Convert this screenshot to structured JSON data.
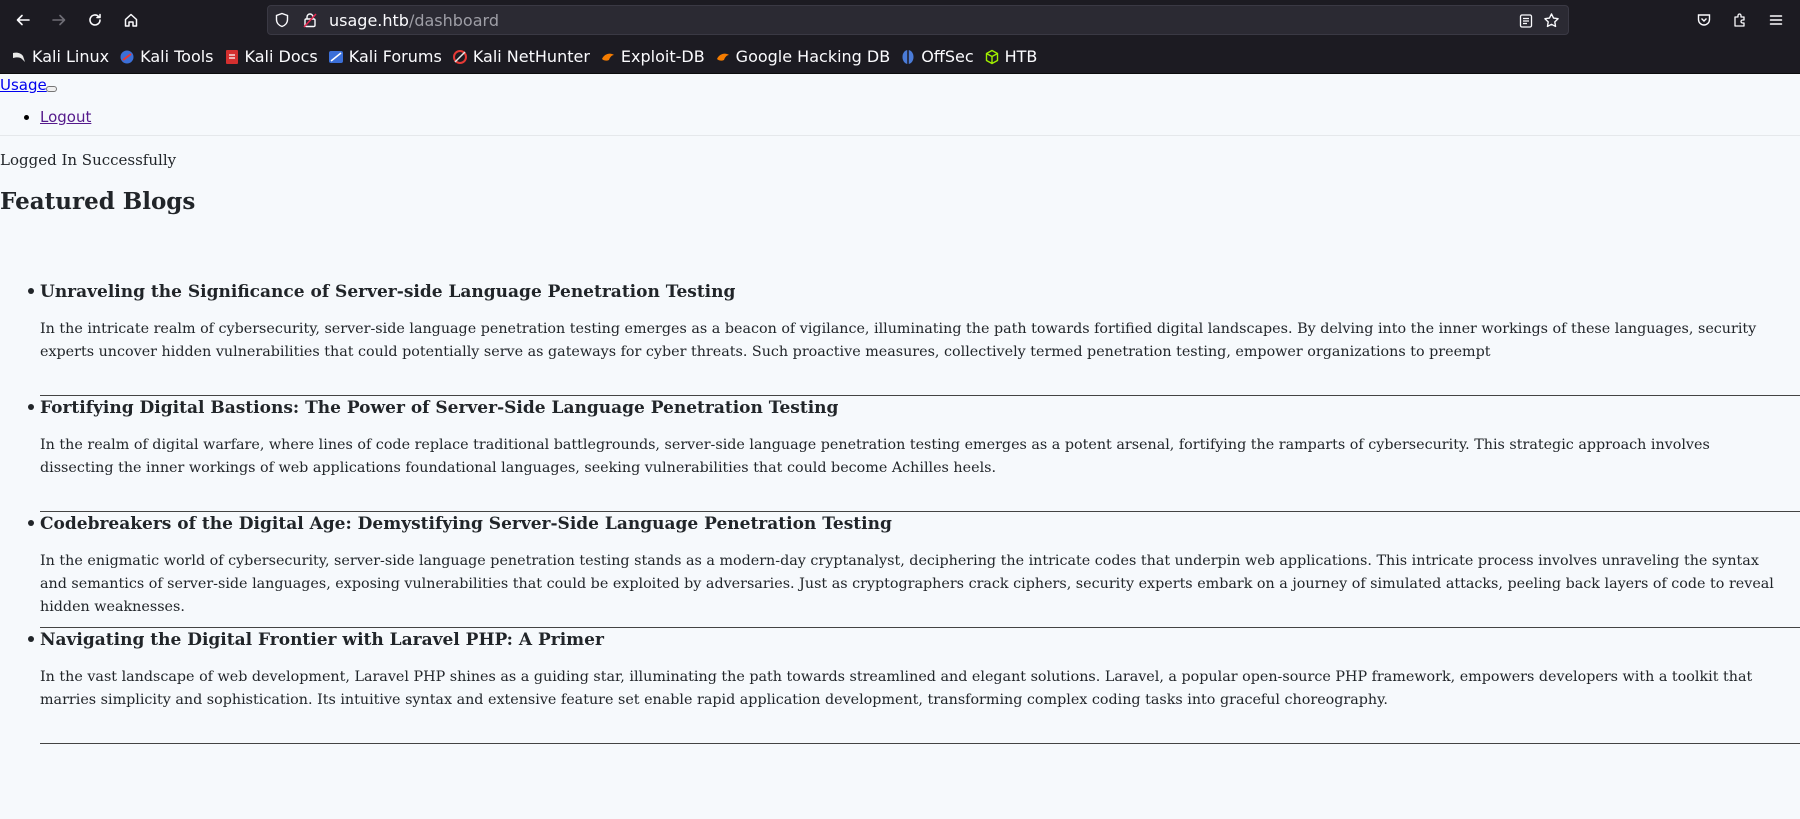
{
  "browser": {
    "url_host": "usage.htb",
    "url_path": "/dashboard",
    "bookmarks": [
      {
        "label": "Kali Linux",
        "icon": "kali-dragon-icon",
        "color": "#2d8ed8"
      },
      {
        "label": "Kali Tools",
        "icon": "kali-tools-icon",
        "color": "#3b6fd8"
      },
      {
        "label": "Kali Docs",
        "icon": "kali-docs-icon",
        "color": "#d32f2f"
      },
      {
        "label": "Kali Forums",
        "icon": "kali-forums-icon",
        "color": "#3b6fd8"
      },
      {
        "label": "Kali NetHunter",
        "icon": "nethunter-icon",
        "color": "#e53935"
      },
      {
        "label": "Exploit-DB",
        "icon": "exploit-db-icon",
        "color": "#f57c00"
      },
      {
        "label": "Google Hacking DB",
        "icon": "ghdb-icon",
        "color": "#f57c00"
      },
      {
        "label": "OffSec",
        "icon": "offsec-icon",
        "color": "#4a7bd8"
      },
      {
        "label": "HTB",
        "icon": "htb-cube-icon",
        "color": "#9fef00"
      }
    ]
  },
  "navbar": {
    "brand": "Usage",
    "logout": "Logout"
  },
  "status_text": "Logged In Successfully",
  "section_title": "Featured Blogs",
  "blogs": [
    {
      "title": "Unraveling the Significance of Server-side Language Penetration Testing",
      "body": "In the intricate realm of cybersecurity, server-side language penetration testing emerges as a beacon of vigilance, illuminating the path towards fortified digital landscapes. By delving into the inner workings of these languages, security experts uncover hidden vulnerabilities that could potentially serve as gateways for cyber threats. Such proactive measures, collectively termed penetration testing, empower organizations to preempt"
    },
    {
      "title": "Fortifying Digital Bastions: The Power of Server-Side Language Penetration Testing",
      "body": "In the realm of digital warfare, where lines of code replace traditional battlegrounds, server-side language penetration testing emerges as a potent arsenal, fortifying the ramparts of cybersecurity. This strategic approach involves dissecting the inner workings of web applications foundational languages, seeking vulnerabilities that could become Achilles heels."
    },
    {
      "title": "Codebreakers of the Digital Age: Demystifying Server-Side Language Penetration Testing",
      "body": "In the enigmatic world of cybersecurity, server-side language penetration testing stands as a modern-day cryptanalyst, deciphering the intricate codes that underpin web applications. This intricate process involves unraveling the syntax and semantics of server-side languages, exposing vulnerabilities that could be exploited by adversaries. Just as cryptographers crack ciphers, security experts embark on a journey of simulated attacks, peeling back layers of code to reveal hidden weaknesses."
    },
    {
      "title": "Navigating the Digital Frontier with Laravel PHP: A Primer",
      "body": "In the vast landscape of web development, Laravel PHP shines as a guiding star, illuminating the path towards streamlined and elegant solutions. Laravel, a popular open-source PHP framework, empowers developers with a toolkit that marries simplicity and sophistication. Its intuitive syntax and extensive feature set enable rapid application development, transforming complex coding tasks into graceful choreography."
    }
  ]
}
